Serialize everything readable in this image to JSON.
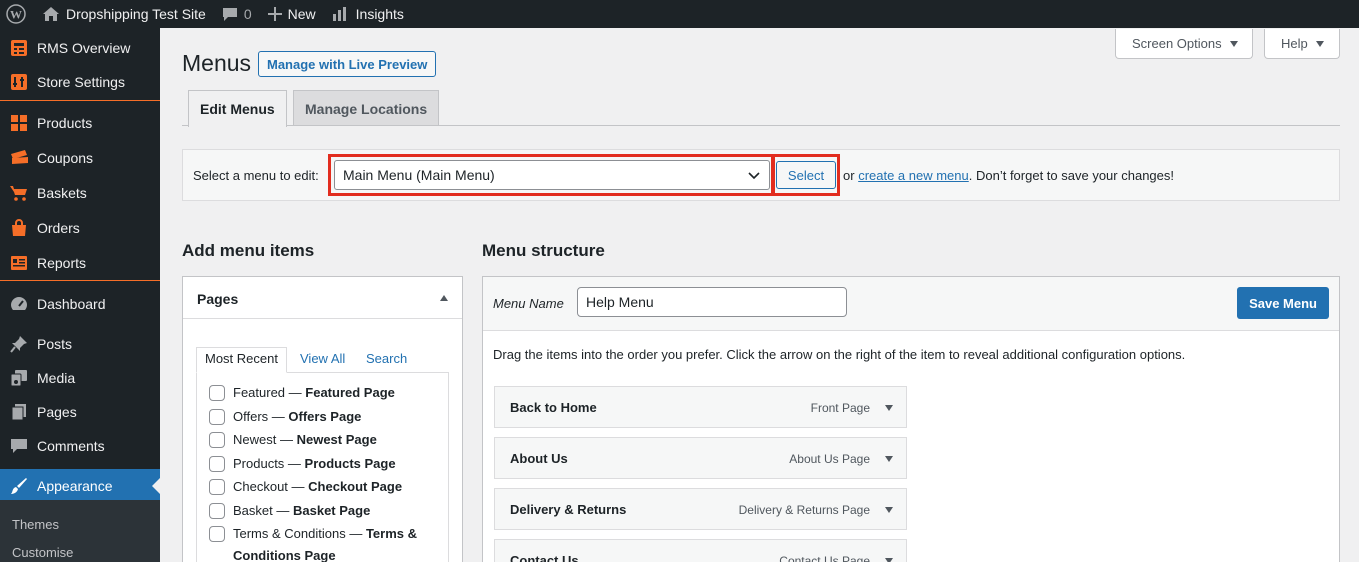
{
  "adminbar": {
    "site_name": "Dropshipping Test Site",
    "comments_count": "0",
    "new_label": "New",
    "insights_label": "Insights"
  },
  "sidebar": {
    "items": [
      {
        "label": "RMS Overview",
        "icon": "calculator-icon"
      },
      {
        "label": "Store Settings",
        "icon": "settings-icon"
      },
      {
        "label": "Products",
        "icon": "grid-icon"
      },
      {
        "label": "Coupons",
        "icon": "coupon-icon"
      },
      {
        "label": "Baskets",
        "icon": "cart-icon"
      },
      {
        "label": "Orders",
        "icon": "bag-icon"
      },
      {
        "label": "Reports",
        "icon": "report-icon"
      },
      {
        "label": "Dashboard",
        "icon": "dashboard-icon"
      },
      {
        "label": "Posts",
        "icon": "pin-icon"
      },
      {
        "label": "Media",
        "icon": "media-icon"
      },
      {
        "label": "Pages",
        "icon": "pages-icon"
      },
      {
        "label": "Comments",
        "icon": "comment-icon"
      },
      {
        "label": "Appearance",
        "icon": "brush-icon"
      }
    ],
    "submenu": [
      {
        "label": "Themes"
      },
      {
        "label": "Customise"
      }
    ],
    "accent_color": "#f56e28",
    "active_color": "#2271b1"
  },
  "screen_options": {
    "label": "Screen Options"
  },
  "help": {
    "label": "Help"
  },
  "page": {
    "title": "Menus",
    "live_preview_label": "Manage with Live Preview"
  },
  "tabs": [
    {
      "label": "Edit Menus"
    },
    {
      "label": "Manage Locations"
    }
  ],
  "select_menu": {
    "label": "Select a menu to edit:",
    "selected": "Main Menu (Main Menu)",
    "button": "Select",
    "or_text": "or",
    "create_link": "create a new menu",
    "after_text": ". Don’t forget to save your changes!"
  },
  "add_items": {
    "heading": "Add menu items",
    "pages_title": "Pages",
    "tabs": [
      "Most Recent",
      "View All",
      "Search"
    ],
    "pages": [
      {
        "name": "Featured",
        "type": "Featured Page"
      },
      {
        "name": "Offers",
        "type": "Offers Page"
      },
      {
        "name": "Newest",
        "type": "Newest Page"
      },
      {
        "name": "Products",
        "type": "Products Page"
      },
      {
        "name": "Checkout",
        "type": "Checkout Page"
      },
      {
        "name": "Basket",
        "type": "Basket Page"
      },
      {
        "name": "Terms & Conditions",
        "type": "Terms & Conditions Page"
      }
    ]
  },
  "structure": {
    "heading": "Menu structure",
    "menu_name_label": "Menu Name",
    "menu_name_value": "Help Menu",
    "save_label": "Save Menu",
    "instructions": "Drag the items into the order you prefer. Click the arrow on the right of the item to reveal additional configuration options.",
    "items": [
      {
        "title": "Back to Home",
        "kind": "Front Page"
      },
      {
        "title": "About Us",
        "kind": "About Us Page"
      },
      {
        "title": "Delivery & Returns",
        "kind": "Delivery & Returns Page"
      },
      {
        "title": "Contact Us",
        "kind": "Contact Us Page"
      }
    ]
  }
}
